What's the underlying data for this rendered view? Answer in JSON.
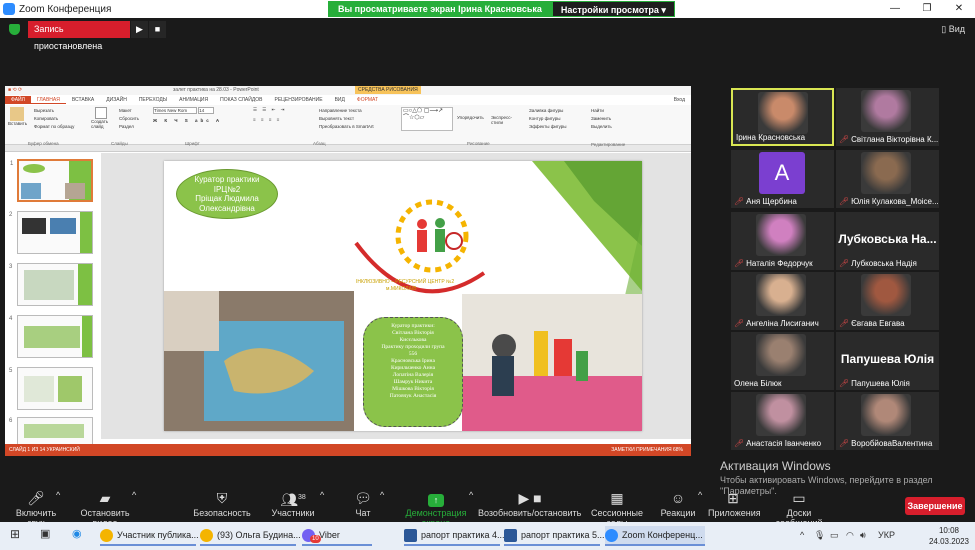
{
  "window": {
    "title": "Zoom Конференция",
    "controls": [
      "—",
      "❐",
      "✕"
    ]
  },
  "banner": {
    "message": "Вы просматриваете экран Ірина Красновська",
    "options": "Настройки просмотра ▾"
  },
  "recording": {
    "label": "Запись приостановлена"
  },
  "view": {
    "label": "▯ Вид"
  },
  "ppt": {
    "doc_title": "залет практика на 28.03 - PowerPoint",
    "context_tab": "СРЕДСТВА РИСОВАНИЯ",
    "tabs": [
      "ФАЙЛ",
      "ГЛАВНАЯ",
      "ВСТАВКА",
      "ДИЗАЙН",
      "ПЕРЕХОДЫ",
      "АНИМАЦИЯ",
      "ПОКАЗ СЛАЙДОВ",
      "РЕЦЕНЗИРОВАНИЕ",
      "ВИД",
      "ФОРМАТ"
    ],
    "ribbon": {
      "paste": "Вставить",
      "cut": "Вырезать",
      "copy": "Копировать",
      "format_painter": "Формат по образцу",
      "clipboard": "Буфер обмена",
      "new_slide": "Создать слайд",
      "layout": "Макет",
      "reset": "Сбросить",
      "section": "Раздел",
      "slides": "Слайды",
      "font_name": "Times New Rom",
      "font_size": "14",
      "font": "Шрифт",
      "paragraph": "Абзац",
      "text_dir": "Направление текста",
      "align_text": "Выровнять текст",
      "smartart": "Преобразовать в SmartArt",
      "arrange": "Упорядочить",
      "quick_styles": "Экспресс-стили",
      "drawing": "Рисование",
      "fill": "Заливка фигуры",
      "outline": "Контур фигуры",
      "effects": "Эффекты фигуры",
      "find": "Найти",
      "replace": "Заменить",
      "select": "Выделить",
      "editing": "Редактирование",
      "login": "Вход"
    },
    "thumb_numbers": [
      "1",
      "2",
      "3",
      "4",
      "5",
      "6"
    ],
    "slide": {
      "curator_lines": [
        "Куратор практики",
        "ІРЦ№2",
        "Пріщак Людмила",
        "Олександрівна"
      ],
      "logo_text": "ІНКЛЮЗИВНО – РЕСУРСНИЙ ЦЕНТР №2",
      "logo_city": "м.МИКОЛАЇВ",
      "practice_lines": [
        "Куратор практики:",
        "Світлана Вікторія",
        "Кисєлькова",
        "Практику проходили група",
        "556",
        "Красновська Ірина",
        "Кирильченко Анна",
        "Лопатіна Валерія",
        "Шамрук Никита",
        "Мішкова Вікторія",
        "Патовчук Анастасія"
      ]
    },
    "status_left": "СЛАЙД 1 ИЗ 14     УКРАИНСКИЙ",
    "status_right": "ЗАМЕТКИ    ПРИМЕЧАНИЯ          68%"
  },
  "participants": [
    {
      "name": "Ірина Красновська",
      "muted": false,
      "active": true,
      "avatar_color": "#c98a6a"
    },
    {
      "name": "Світлана Вікторівна К...",
      "muted": true,
      "avatar_color": "#b07aa0"
    },
    {
      "name": "Аня Щербина",
      "muted": true,
      "letter": "A",
      "avatar_color": "#7b3fd0"
    },
    {
      "name": "Юлія Кулакова_Моісе...",
      "muted": true,
      "avatar_color": "#8a6a50"
    },
    {
      "name": "Наталія Федорчук",
      "muted": true,
      "avatar_color": "#d080c0"
    },
    {
      "name": "Лубковська Надія",
      "muted": true,
      "big": "Лубковська На..."
    },
    {
      "name": "Ангеліна Лисиганич",
      "muted": true,
      "avatar_color": "#d8b090"
    },
    {
      "name": "Євгава Евгава",
      "muted": true,
      "avatar_color": "#a05840"
    },
    {
      "name": "Олена Білюк",
      "muted": false,
      "avatar_color": "#9a8070"
    },
    {
      "name": "Папушева Юлія",
      "muted": true,
      "big": "Папушева Юлія"
    },
    {
      "name": "Анастасія Іванченко",
      "muted": true,
      "avatar_color": "#c090a0"
    },
    {
      "name": "ВоробйоваВалентина",
      "muted": true,
      "avatar_color": "#b08878"
    }
  ],
  "activation": {
    "title": "Активация Windows",
    "text": "Чтобы активировать Windows, перейдите в раздел \"Параметры\"."
  },
  "toolbar": {
    "mute": "Включить звук",
    "video": "Остановить видео",
    "security": "Безопасность",
    "participants": "Участники",
    "participants_count": "38",
    "chat": "Чат",
    "share": "Демонстрация экрана",
    "record": "Возобновить/остановить запись",
    "breakout": "Сессионные залы",
    "reactions": "Реакции",
    "apps": "Приложения",
    "whiteboard": "Доски сообщений",
    "end": "Завершение"
  },
  "taskbar": {
    "apps": [
      {
        "label": "Участник публика...",
        "color": "#f4b400"
      },
      {
        "label": "(93) Ольга Будина...",
        "color": "#f4b400"
      },
      {
        "label": "Viber",
        "color": "#7360f2"
      },
      {
        "label": "рапорт практика 4...",
        "color": "#2b5797"
      },
      {
        "label": "рапорт практика 5...",
        "color": "#2b5797"
      },
      {
        "label": "Zoom Конференц...",
        "color": "#2d8cff"
      }
    ],
    "viber_badge": "10",
    "lang": "УКР",
    "time": "10:08",
    "date": "24.03.2023"
  }
}
